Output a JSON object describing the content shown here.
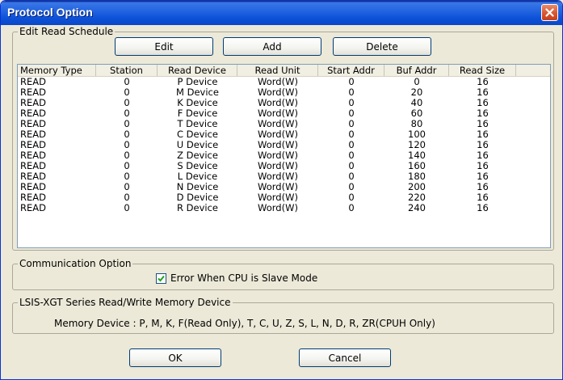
{
  "window": {
    "title": "Protocol Option"
  },
  "schedule": {
    "group_label": "Edit Read Schedule",
    "buttons": {
      "edit": "Edit",
      "add": "Add",
      "delete": "Delete"
    },
    "columns": [
      "Memory Type",
      "Station",
      "Read Device",
      "Read Unit",
      "Start Addr",
      "Buf Addr",
      "Read Size"
    ],
    "rows": [
      [
        "READ",
        "0",
        "P Device",
        "Word(W)",
        "0",
        "0",
        "16"
      ],
      [
        "READ",
        "0",
        "M Device",
        "Word(W)",
        "0",
        "20",
        "16"
      ],
      [
        "READ",
        "0",
        "K Device",
        "Word(W)",
        "0",
        "40",
        "16"
      ],
      [
        "READ",
        "0",
        "F Device",
        "Word(W)",
        "0",
        "60",
        "16"
      ],
      [
        "READ",
        "0",
        "T Device",
        "Word(W)",
        "0",
        "80",
        "16"
      ],
      [
        "READ",
        "0",
        "C Device",
        "Word(W)",
        "0",
        "100",
        "16"
      ],
      [
        "READ",
        "0",
        "U Device",
        "Word(W)",
        "0",
        "120",
        "16"
      ],
      [
        "READ",
        "0",
        "Z Device",
        "Word(W)",
        "0",
        "140",
        "16"
      ],
      [
        "READ",
        "0",
        "S Device",
        "Word(W)",
        "0",
        "160",
        "16"
      ],
      [
        "READ",
        "0",
        "L Device",
        "Word(W)",
        "0",
        "180",
        "16"
      ],
      [
        "READ",
        "0",
        "N Device",
        "Word(W)",
        "0",
        "200",
        "16"
      ],
      [
        "READ",
        "0",
        "D Device",
        "Word(W)",
        "0",
        "220",
        "16"
      ],
      [
        "READ",
        "0",
        "R Device",
        "Word(W)",
        "0",
        "240",
        "16"
      ]
    ]
  },
  "communication": {
    "group_label": "Communication Option",
    "checkbox_label": "Error When CPU is Slave Mode",
    "checked": true
  },
  "device_info": {
    "group_label": "LSIS-XGT Series Read/Write Memory Device",
    "text": "Memory Device : P,  M,  K,  F(Read Only),  T,  C,  U,  Z,  S,  L,  N,  D,  R,  ZR(CPUH Only)"
  },
  "footer": {
    "ok": "OK",
    "cancel": "Cancel"
  },
  "colors": {
    "titlebar": "#0d52d9",
    "dialog_bg": "#ece9d8",
    "close_button": "#d6532c"
  },
  "icons": {
    "close": "close-icon",
    "check": "checkmark-icon"
  }
}
